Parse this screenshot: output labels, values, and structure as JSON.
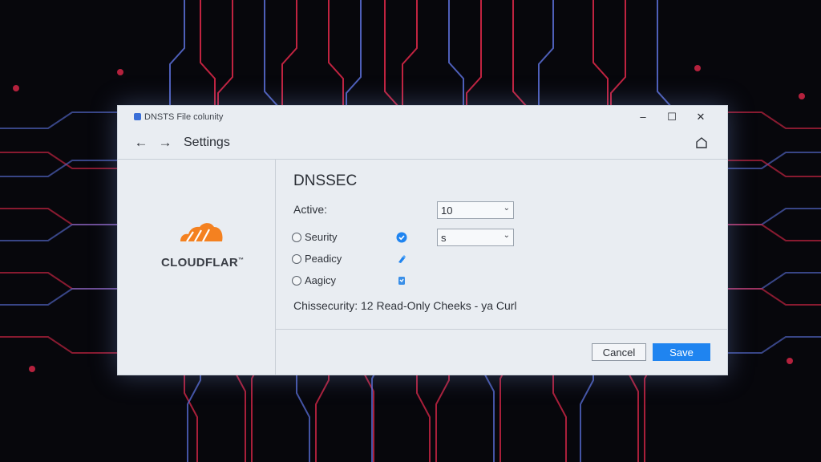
{
  "window": {
    "title": "DNSTS File colunity",
    "controls": {
      "minimize": "–",
      "maximize": "☐",
      "close": "✕"
    }
  },
  "nav": {
    "back_icon": "arrow-left-icon",
    "forward_icon": "arrow-right-icon",
    "title": "Settings",
    "home_icon": "home-icon"
  },
  "sidebar": {
    "logo_text": "CLOUDFLAR",
    "logo_mark": "™",
    "logo_color": "#f48120"
  },
  "content": {
    "section_title": "DNSSEC",
    "active_label": "Active:",
    "active_select_value": "10",
    "options": [
      {
        "label": "Seurity",
        "checked": false,
        "icon": "check-circle-icon"
      },
      {
        "label": "Peadicy",
        "checked": false,
        "icon": "pin-icon"
      },
      {
        "label": "Aagicy",
        "checked": false,
        "icon": "badge-icon"
      }
    ],
    "option_select_value": "s",
    "summary": "Chissecurity: 12 Read-Only Cheeks - ya Curl"
  },
  "footer": {
    "cancel_label": "Cancel",
    "save_label": "Save"
  },
  "colors": {
    "accent": "#1f84f0",
    "circuit_red": "#e0284a",
    "circuit_blue": "#5a6fd8"
  }
}
